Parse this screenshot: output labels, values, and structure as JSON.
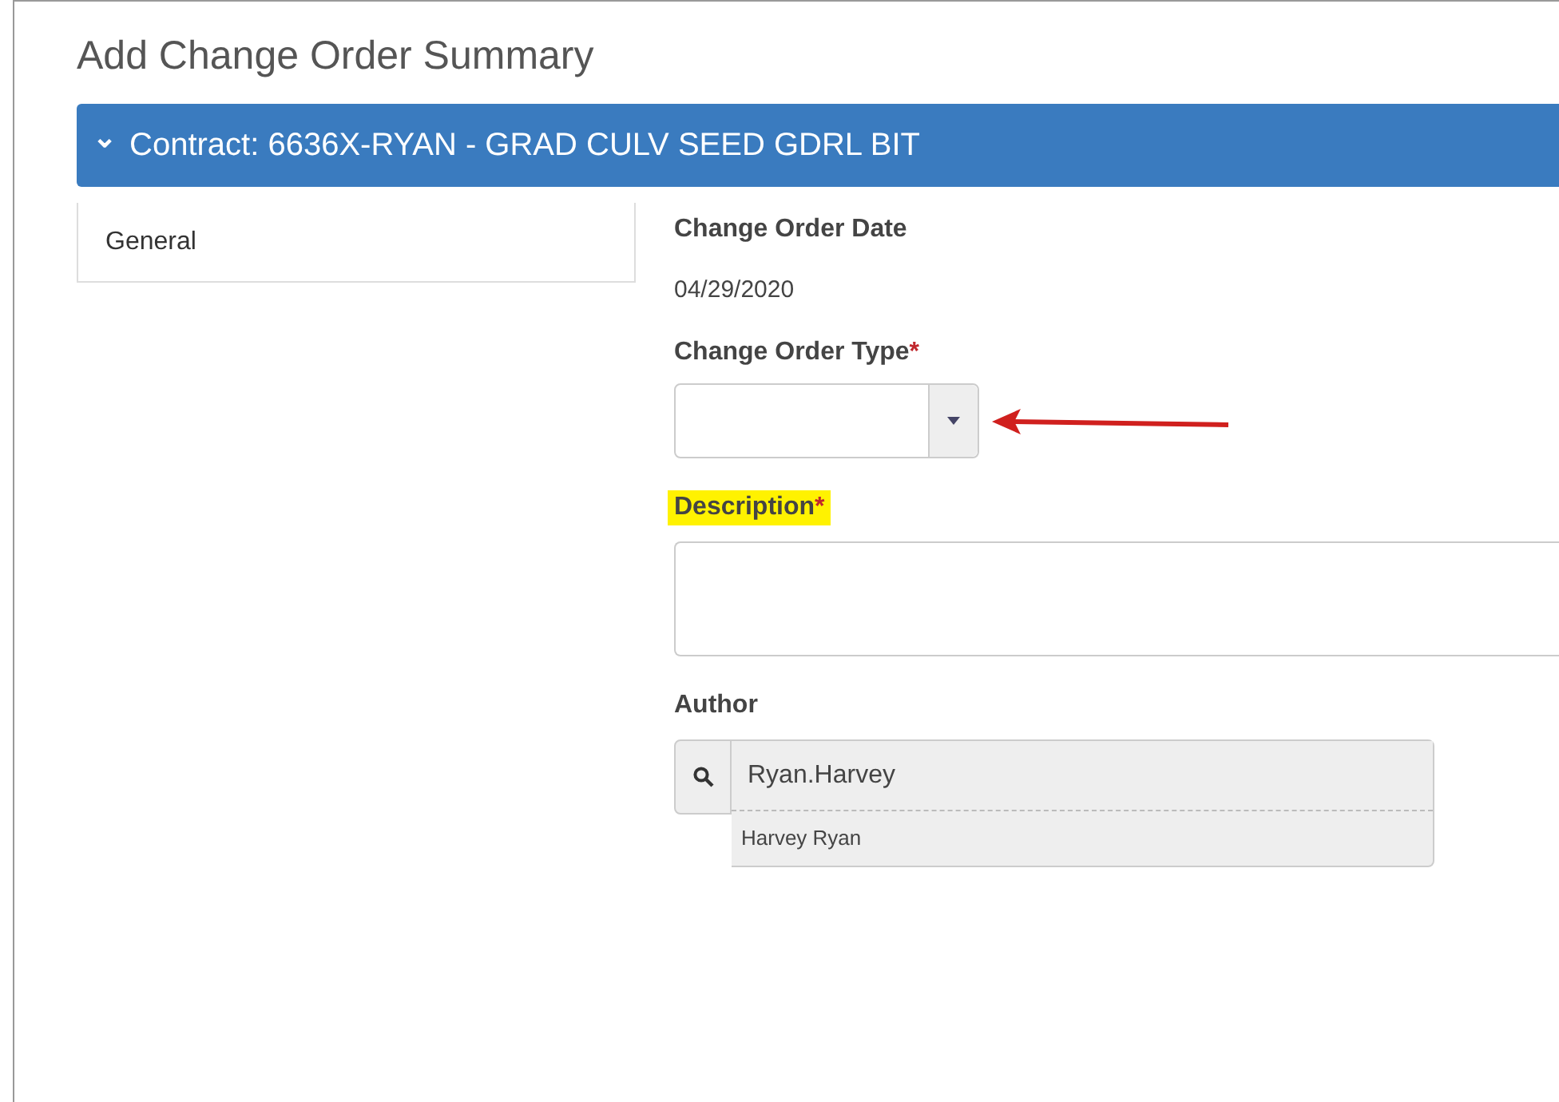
{
  "page": {
    "title": "Add Change Order Summary"
  },
  "contract_bar": {
    "icon": "⌄",
    "label": "Contract: 6636X-RYAN - GRAD CULV SEED GDRL BIT",
    "expanded": true
  },
  "sidebar": {
    "items": [
      {
        "label": "General",
        "selected": true
      }
    ]
  },
  "form": {
    "fields": [
      {
        "kind": "readonly",
        "label": "Change Order Date",
        "required": false,
        "highlighted": false,
        "value": "04/29/2020"
      },
      {
        "kind": "select",
        "label": "Change Order Type",
        "required": true,
        "highlighted": false,
        "annotated": true
      },
      {
        "kind": "textarea",
        "label": "Description",
        "required": true,
        "highlighted": true
      },
      {
        "kind": "lookup",
        "label": "Author",
        "required": false,
        "highlighted": false,
        "value": "Ryan.Harvey",
        "suggestion": "Harvey Ryan"
      }
    ]
  },
  "required_mark": "*"
}
